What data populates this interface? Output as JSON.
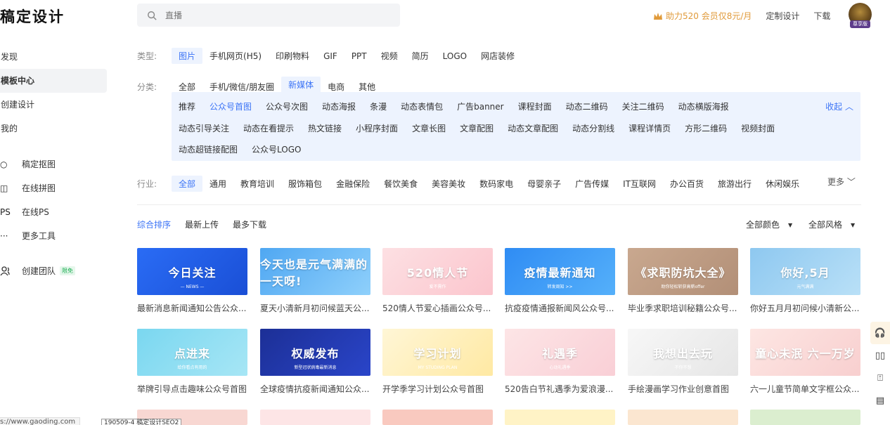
{
  "header": {
    "logo": "稿定设计",
    "search_placeholder": "直播",
    "promo": "助力520 会员仅8元/月",
    "custom_design": "定制设计",
    "download": "下载",
    "avatar_badge": "尊享版"
  },
  "sidebar": {
    "nav": [
      "发现",
      "模板中心",
      "创建设计",
      "我的"
    ],
    "tools": [
      {
        "icon": "cutout-icon",
        "glyph": "○",
        "label": "稿定抠图"
      },
      {
        "icon": "collage-icon",
        "glyph": "◫",
        "label": "在线拼图"
      },
      {
        "icon": "ps-icon",
        "glyph": "PS",
        "label": "在线PS"
      },
      {
        "icon": "more-dots-icon",
        "glyph": "···",
        "label": "更多工具"
      }
    ],
    "team": {
      "label": "创建团队",
      "tag": "限免"
    }
  },
  "filters": {
    "type_label": "类型:",
    "types": [
      "图片",
      "手机网页(H5)",
      "印刷物料",
      "GIF",
      "PPT",
      "视频",
      "简历",
      "LOGO",
      "网店装修"
    ],
    "category_label": "分类:",
    "categories": [
      "全部",
      "手机/微信/朋友圈",
      "新媒体",
      "电商",
      "其他"
    ],
    "sub_line1": [
      "推荐",
      "公众号首图",
      "公众号次图",
      "动态海报",
      "条漫",
      "动态表情包",
      "广告banner",
      "课程封面",
      "动态二维码",
      "关注二维码",
      "动态横版海报"
    ],
    "sub_line2": [
      "动态引导关注",
      "动态在看提示",
      "热文链接",
      "小程序封面",
      "文章长图",
      "文章配图",
      "动态文章配图",
      "动态分割线",
      "课程详情页",
      "方形二维码",
      "视频封面"
    ],
    "sub_line3": [
      "动态超链接配图",
      "公众号LOGO"
    ],
    "collapse": "收起",
    "industry_label": "行业:",
    "industries": [
      "全部",
      "通用",
      "教育培训",
      "服饰箱包",
      "金融保险",
      "餐饮美食",
      "美容美妆",
      "数码家电",
      "母婴亲子",
      "广告传媒",
      "IT互联网",
      "办公百货",
      "旅游出行",
      "休闲娱乐"
    ],
    "more": "更多"
  },
  "sort": {
    "options": [
      "综合排序",
      "最新上传",
      "最多下载"
    ],
    "color": "全部颜色",
    "style": "全部风格"
  },
  "cards": [
    {
      "title": "最新消息新闻通知公告公众...",
      "big": "今日关注",
      "small": "— NEWS —",
      "bg": "linear-gradient(135deg,#2a6cf5,#1a4fd6)"
    },
    {
      "title": "夏天小清新月初问候蓝天公...",
      "big": "今天也是元气满满的一天呀!",
      "small": "",
      "bg": "linear-gradient(135deg,#4fa7f2,#8fd0fb)"
    },
    {
      "title": "520情人节爱心插画公众号...",
      "big": "520情人节",
      "small": "爱不需作",
      "bg": "linear-gradient(135deg,#fde0e3,#fbc5cd)"
    },
    {
      "title": "抗疫疫情通报新闻风公众号...",
      "big": "疫情最新通知",
      "small": "转发周知 >>",
      "bg": "linear-gradient(135deg,#2f8cf4,#55b0fa)"
    },
    {
      "title": "毕业季求职培训秘籍公众号...",
      "big": "《求职防坑大全》",
      "small": "助你轻松斩获高薪offer",
      "bg": "linear-gradient(135deg,#c9a88f,#b28f77)"
    },
    {
      "title": "你好五月月初问候小清新公...",
      "big": "你好,5月",
      "small": "元气满满",
      "bg": "linear-gradient(135deg,#8ec8f0,#b9e0f7)"
    },
    {
      "title": "举牌引导点击趣味公众号首图",
      "big": "点进来",
      "small": "给你看点有用的",
      "bg": "linear-gradient(135deg,#7ad7f0,#a7e6f5)"
    },
    {
      "title": "全球疫情抗疫新闻通知公众...",
      "big": "权威发布",
      "small": "新型冠状病毒最新消息",
      "bg": "linear-gradient(135deg,#1c2f96,#2a45c9)"
    },
    {
      "title": "开学季学习计划公众号首图",
      "big": "学习计划",
      "small": "MY STUDING PLAN",
      "bg": "linear-gradient(135deg,#fff6d6,#ffe9a3)"
    },
    {
      "title": "520告白节礼遇季为爱浪漫...",
      "big": "礼遇季",
      "small": "心动礼遇季",
      "bg": "linear-gradient(135deg,#fde5e6,#f9cfd6)"
    },
    {
      "title": "手绘漫画学习作业创意首图",
      "big": "我想出去玩",
      "small": "不你不想",
      "bg": "linear-gradient(135deg,#f7f7f7,#e6e6e6)"
    },
    {
      "title": "六一儿童节简单文字框公众...",
      "big": "童心未泯 六一万岁",
      "small": "",
      "bg": "linear-gradient(135deg,#fde6e3,#f8cfcf)"
    }
  ],
  "right_tools": [
    "headset-icon",
    "book-icon",
    "person-add-icon",
    "message-icon"
  ],
  "status_bar": {
    "url": "s://www.gaoding.com",
    "tip": "190509-4 稿定设计SEO2"
  },
  "colors": {
    "accent": "#3c74f6",
    "promo": "#e09a3a",
    "chip_bg": "#edf3fe"
  }
}
